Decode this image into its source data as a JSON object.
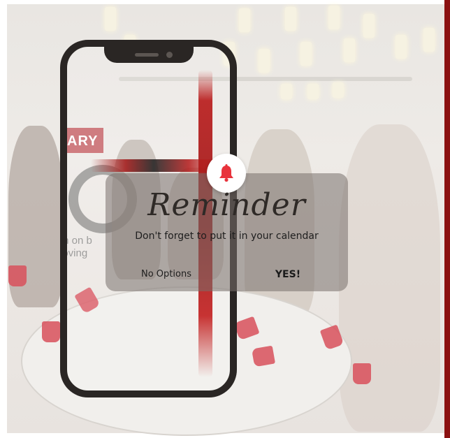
{
  "dialog": {
    "title": "Reminder",
    "message": "Don't forget to put it in your calendar",
    "no_label": "No Options",
    "yes_label": "YES!"
  },
  "background": {
    "sign_text": "ARY",
    "poster_text": "th on b\nloving"
  },
  "icons": {
    "bell": "bell-icon"
  },
  "colors": {
    "bell_red": "#e8333c",
    "accent_red": "#b81818",
    "phone_frame": "#2a2624"
  }
}
